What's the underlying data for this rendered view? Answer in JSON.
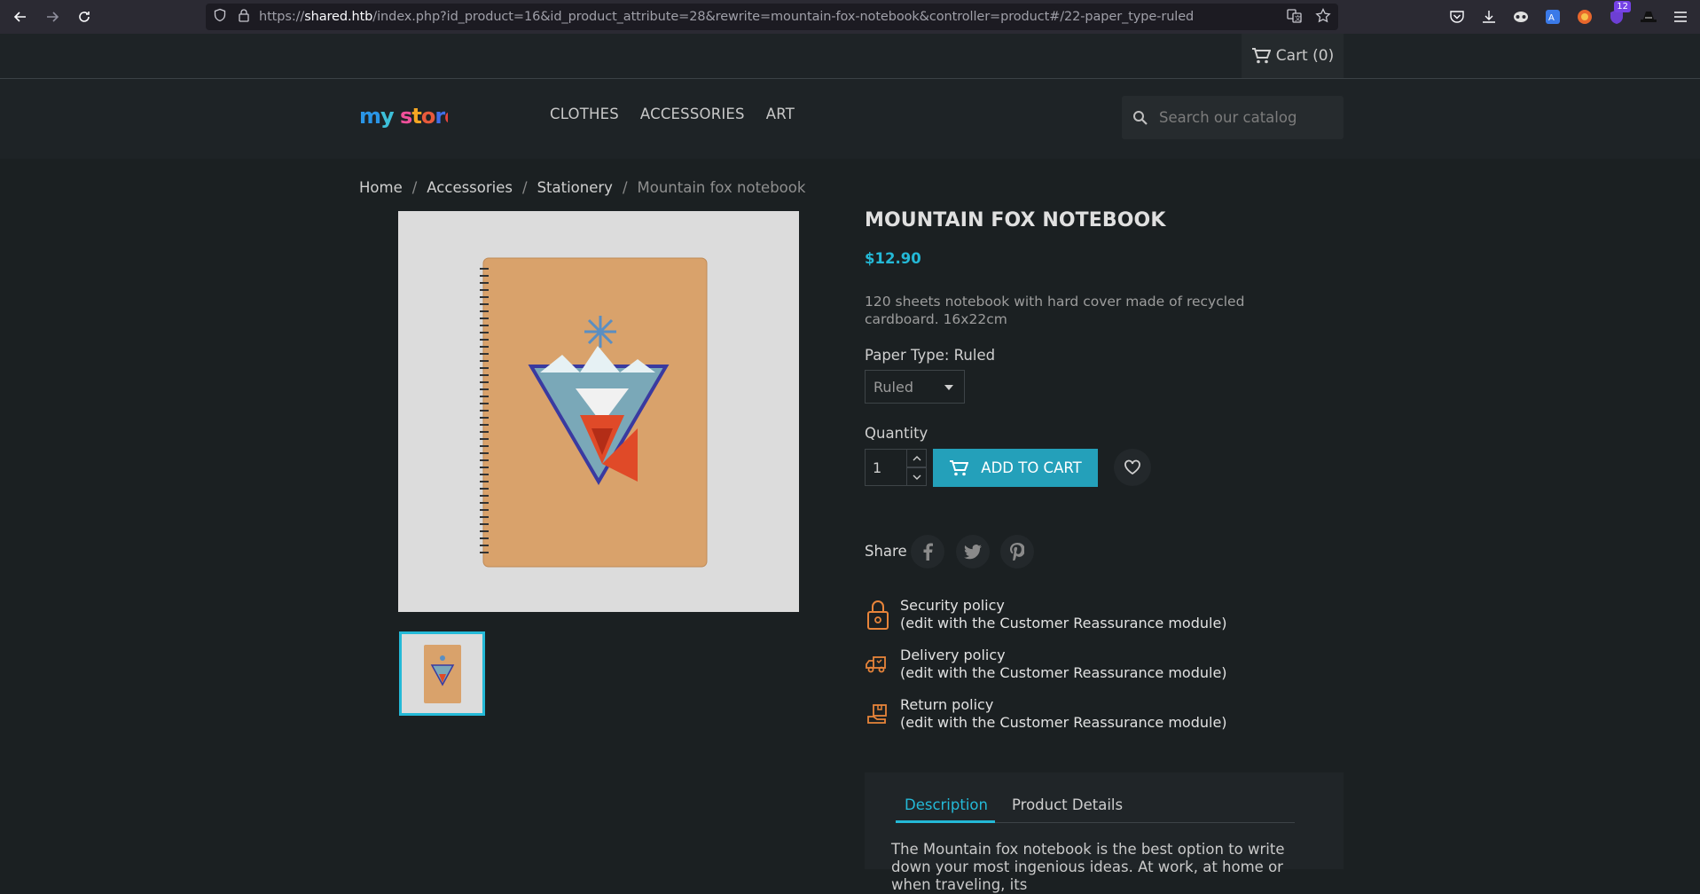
{
  "browser": {
    "url_prefix": "https://",
    "url_host": "shared.htb",
    "url_rest": "/index.php?id_product=16&id_product_attribute=28&rewrite=mountain-fox-notebook&controller=product#/22-paper_type-ruled",
    "extensions_badge": "12"
  },
  "topbar": {
    "cart_label": "Cart (0)"
  },
  "header": {
    "logo_text": "my store",
    "menu": [
      "CLOTHES",
      "ACCESSORIES",
      "ART"
    ],
    "search_placeholder": "Search our catalog"
  },
  "breadcrumb": [
    "Home",
    "Accessories",
    "Stationery",
    "Mountain fox notebook"
  ],
  "product": {
    "title": "MOUNTAIN FOX NOTEBOOK",
    "price": "$12.90",
    "description": "120 sheets notebook with hard cover made of recycled cardboard. 16x22cm",
    "paper_type_label": "Paper Type: Ruled",
    "paper_type_value": "Ruled",
    "quantity_label": "Quantity",
    "quantity_value": "1",
    "add_to_cart": "ADD TO CART",
    "share_label": "Share"
  },
  "reassurance": [
    {
      "title": "Security policy",
      "sub": "(edit with the Customer Reassurance module)",
      "icon": "lock-icon"
    },
    {
      "title": "Delivery policy",
      "sub": "(edit with the Customer Reassurance module)",
      "icon": "truck-icon"
    },
    {
      "title": "Return policy",
      "sub": "(edit with the Customer Reassurance module)",
      "icon": "return-box-icon"
    }
  ],
  "tabs": {
    "items": [
      "Description",
      "Product Details"
    ],
    "active": "Description",
    "text": "The Mountain fox notebook is the best option to write down your most ingenious ideas. At work, at home or when traveling, its"
  },
  "colors": {
    "accent": "#24b9d7",
    "button": "#24a0ba",
    "background": "#1b2022",
    "icon_orange": "#e8843a"
  }
}
